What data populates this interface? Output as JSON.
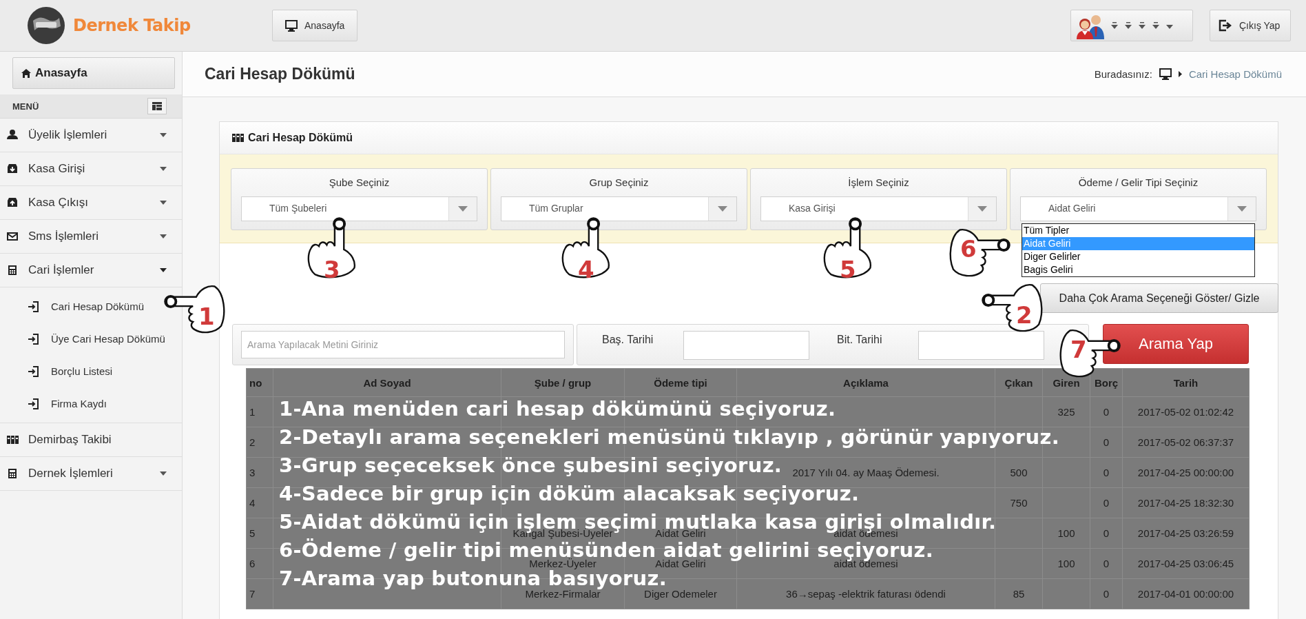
{
  "header": {
    "logo_text": "Dernek Takip",
    "home_button": "Anasayfa",
    "logout_button": "Çıkış Yap"
  },
  "sidebar": {
    "home_button": "Anasayfa",
    "menu_title": "MENÜ",
    "items": [
      {
        "label": "Üyelik İşlemleri",
        "expanded": false
      },
      {
        "label": "Kasa Girişi",
        "expanded": false
      },
      {
        "label": "Kasa Çıkışı",
        "expanded": false
      },
      {
        "label": "Sms İşlemleri",
        "expanded": false
      },
      {
        "label": "Cari İşlemler",
        "expanded": true,
        "children": [
          {
            "label": "Cari Hesap Dökümü"
          },
          {
            "label": "Üye Cari Hesap Dökümü"
          },
          {
            "label": "Borçlu Listesi"
          },
          {
            "label": "Firma Kaydı"
          }
        ]
      },
      {
        "label": "Demirbaş Takibi"
      },
      {
        "label": "Dernek İşlemleri",
        "expanded": false
      }
    ]
  },
  "page": {
    "title": "Cari Hesap Dökümü",
    "breadcrumb_label": "Buradasınız:",
    "breadcrumb_current": "Cari Hesap Dökümü"
  },
  "panel": {
    "title": "Cari Hesap Dökümü",
    "filters": [
      {
        "label": "Şube Seçiniz",
        "value": "Tüm Şubeleri"
      },
      {
        "label": "Grup Seçiniz",
        "value": "Tüm Gruplar"
      },
      {
        "label": "İşlem Seçiniz",
        "value": "Kasa Girişi"
      },
      {
        "label": "Ödeme / Gelir Tipi Seçiniz",
        "value": "Aidat Geliri",
        "options": [
          {
            "label": "Tüm Tipler",
            "selected": false
          },
          {
            "label": "Aidat Geliri",
            "selected": true
          },
          {
            "label": "Diger Gelirler",
            "selected": false
          },
          {
            "label": "Bagis Geliri",
            "selected": false
          }
        ]
      }
    ],
    "more_options_button": "Daha Çok Arama Seçeneği Göster/ Gizle",
    "search": {
      "placeholder": "Arama Yapılacak Metini Giriniz"
    },
    "start_date_label": "Baş. Tarihi",
    "end_date_label": "Bit. Tarihi",
    "search_button": "Arama Yap"
  },
  "table": {
    "columns": [
      "no",
      "Ad Soyad",
      "Şube / grup",
      "Ödeme tipi",
      "Açıklama",
      "Çıkan",
      "Giren",
      "Borç",
      "Tarih"
    ],
    "rows": [
      [
        "1",
        "",
        "",
        "",
        "",
        "",
        "325",
        "0",
        "2017-05-02 01:02:42"
      ],
      [
        "2",
        "",
        "",
        "",
        "",
        "",
        "",
        "0",
        "2017-05-02 06:37:37"
      ],
      [
        "3",
        "",
        "",
        "",
        "2017 Yılı 04. ay Maaş Ödemesi.",
        "500",
        "",
        "0",
        "2017-04-25 00:00:00"
      ],
      [
        "4",
        "",
        "",
        "",
        "",
        "750",
        "",
        "0",
        "2017-04-25 18:32:30"
      ],
      [
        "5",
        "",
        "Kangal Şubesi-Üyeler",
        "Aidat Geliri",
        "aidat ödemesi",
        "",
        "100",
        "0",
        "2017-04-25 03:26:59"
      ],
      [
        "6",
        "",
        "Merkez-Üyeler",
        "Aidat Geliri",
        "aidat ödemesi",
        "",
        "100",
        "0",
        "2017-04-25 03:06:45"
      ],
      [
        "7",
        "",
        "Merkez-Firmalar",
        "Diger Odemeler",
        "36→sepaş -elektrik faturası ödendi",
        "85",
        "",
        "0",
        "2017-04-01 00:00:00"
      ]
    ]
  },
  "instructions": [
    "1-Ana menüden cari hesap dökümünü seçiyoruz.",
    "2-Detaylı arama seçenekleri menüsünü tıklayıp , görünür yapıyoruz.",
    "3-Grup seçeceksek önce şubesini seçiyoruz.",
    "4-Sadece bir grup için döküm alacaksak seçiyoruz.",
    "5-Aidat dökümü için işlem seçimi mutlaka kasa girişi olmalıdır.",
    "6-Ödeme / gelir tipi menüsünden aidat gelirini seçiyoruz.",
    "7-Arama yap butonuna basıyoruz."
  ],
  "callouts": [
    {
      "number": "1"
    },
    {
      "number": "2"
    },
    {
      "number": "3"
    },
    {
      "number": "4"
    },
    {
      "number": "5"
    },
    {
      "number": "6"
    },
    {
      "number": "7"
    }
  ]
}
